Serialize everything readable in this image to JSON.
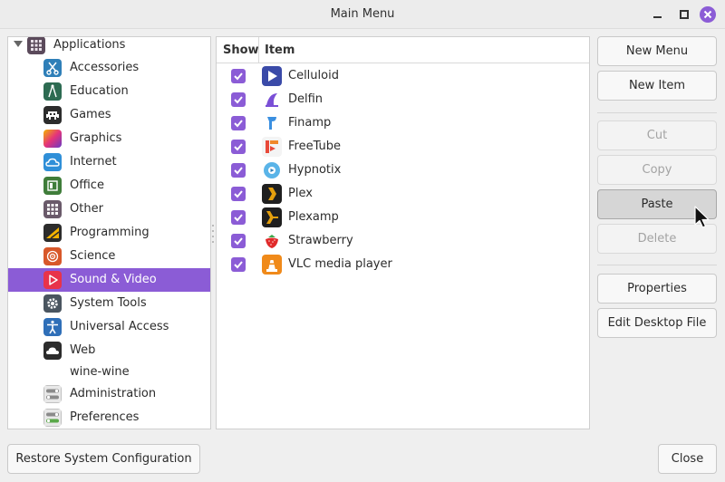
{
  "window": {
    "title": "Main Menu",
    "controls": {
      "minimize_icon": "minimize-icon",
      "maximize_icon": "maximize-icon",
      "close_icon": "close-icon",
      "close_color": "#8b5cd6"
    }
  },
  "accent_color": "#8b5cd6",
  "tree": {
    "root_label": "Applications",
    "root_icon": "applications-grid-icon",
    "categories": [
      {
        "label": "Accessories",
        "icon": "scissors-icon",
        "color": "#2f7fb8"
      },
      {
        "label": "Education",
        "icon": "compass-icon",
        "color": "#2d6b52"
      },
      {
        "label": "Games",
        "icon": "invader-icon",
        "color": "#2c2c2c"
      },
      {
        "label": "Graphics",
        "icon": "rainbow-icon",
        "color": "#c43b9b"
      },
      {
        "label": "Internet",
        "icon": "cloud-icon",
        "color": "#2f8fd8"
      },
      {
        "label": "Office",
        "icon": "office-icon",
        "color": "#3f7d3a"
      },
      {
        "label": "Other",
        "icon": "grid-icon",
        "color": "#6a5a6a"
      },
      {
        "label": "Programming",
        "icon": "programming-icon",
        "color": "#2c2c2c"
      },
      {
        "label": "Science",
        "icon": "atom-icon",
        "color": "#d8582a"
      },
      {
        "label": "Sound & Video",
        "icon": "play-icon",
        "color": "#e8334a",
        "selected": true
      },
      {
        "label": "System Tools",
        "icon": "gear-icon",
        "color": "#4a5560"
      },
      {
        "label": "Universal Access",
        "icon": "accessibility-icon",
        "color": "#2f6fb8"
      },
      {
        "label": "Web",
        "icon": "web-cloud-icon",
        "color": "#2c2c2c"
      },
      {
        "label": "wine-wine",
        "icon": "",
        "color": ""
      },
      {
        "label": "Administration",
        "icon": "toggle-icon",
        "color": "#8a8a8a"
      },
      {
        "label": "Preferences",
        "icon": "toggle-green-icon",
        "color": "#8a8a8a"
      }
    ]
  },
  "items_table": {
    "columns": [
      "Show",
      "Item"
    ],
    "rows": [
      {
        "show": true,
        "name": "Celluloid",
        "icon": "celluloid-icon"
      },
      {
        "show": true,
        "name": "Delfin",
        "icon": "delfin-icon"
      },
      {
        "show": true,
        "name": "Finamp",
        "icon": "finamp-icon"
      },
      {
        "show": true,
        "name": "FreeTube",
        "icon": "freetube-icon"
      },
      {
        "show": true,
        "name": "Hypnotix",
        "icon": "hypnotix-icon"
      },
      {
        "show": true,
        "name": "Plex",
        "icon": "plex-icon"
      },
      {
        "show": true,
        "name": "Plexamp",
        "icon": "plexamp-icon"
      },
      {
        "show": true,
        "name": "Strawberry",
        "icon": "strawberry-icon"
      },
      {
        "show": true,
        "name": "VLC media player",
        "icon": "vlc-icon"
      }
    ]
  },
  "buttons": {
    "new_menu": "New Menu",
    "new_item": "New Item",
    "cut": "Cut",
    "copy": "Copy",
    "paste": "Paste",
    "delete": "Delete",
    "properties": "Properties",
    "edit_desktop_file": "Edit Desktop File",
    "restore": "Restore System Configuration",
    "close": "Close"
  }
}
